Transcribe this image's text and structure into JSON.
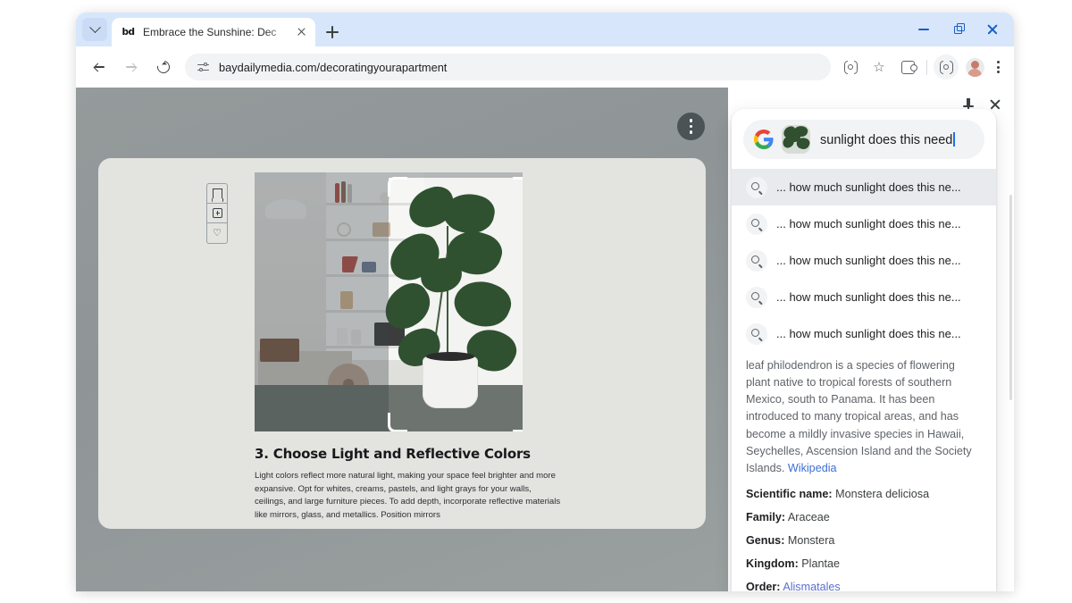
{
  "window": {
    "tab_search_icon": "chevron-down-icon",
    "minimize_label": "—",
    "restore_label": "restore",
    "close_label": "✕"
  },
  "tab": {
    "favicon_text": "bd",
    "title": "Embrace the Sunshine: Dec",
    "close_label": "✕",
    "new_tab_label": "+"
  },
  "toolbar": {
    "back_label": "back",
    "forward_label": "forward",
    "reload_label": "reload",
    "site_info_icon": "tune-icon",
    "url": "baydailymedia.com/decoratingyourapartment",
    "lens_icon": "lens-icon",
    "bookmark_star": "☆",
    "extensions_icon": "puzzle-icon",
    "lens_active_icon": "lens-icon",
    "avatar_icon": "avatar",
    "menu_icon": "kebab-icon"
  },
  "page": {
    "card_actions": [
      "bookmark-icon",
      "comment-add-icon",
      "heart-icon"
    ],
    "heart_glyph": "♡",
    "overflow_menu": "page-kebab",
    "article": {
      "heading": "3. Choose Light and Reflective Colors",
      "body": "Light colors reflect more natural light, making your space feel brighter and more expansive. Opt for whites, creams, pastels, and light grays for your walls, ceilings, and large furniture pieces. To add depth, incorporate reflective materials like mirrors, glass, and metallics. Position mirrors"
    }
  },
  "sidepanel": {
    "pin_label": "pin",
    "close_label": "close",
    "search": {
      "google_logo": "google-g-icon",
      "thumbnail": "selection-thumbnail",
      "query": "sunlight does this need"
    },
    "suggestions": [
      {
        "text": "... how much sunlight does this ne...",
        "selected": true
      },
      {
        "text": "... how much sunlight does this ne...",
        "selected": false
      },
      {
        "text": "... how much sunlight does this ne...",
        "selected": false
      },
      {
        "text": "... how much sunlight does this ne...",
        "selected": false
      },
      {
        "text": "... how much sunlight does this ne...",
        "selected": false
      }
    ],
    "knowledge": {
      "description": "leaf philodendron is a species of flowering plant native to tropical forests of southern Mexico, south to Panama. It has been introduced to many tropical areas, and has become a mildly invasive species in Hawaii, Seychelles, Ascension Island and the Society Islands. ",
      "source_link": "Wikipedia",
      "facts": [
        {
          "label": "Scientific name:",
          "value": "Monstera deliciosa",
          "is_link": false
        },
        {
          "label": "Family:",
          "value": "Araceae",
          "is_link": false
        },
        {
          "label": "Genus:",
          "value": "Monstera",
          "is_link": false
        },
        {
          "label": "Kingdom:",
          "value": "Plantae",
          "is_link": false
        },
        {
          "label": "Order:",
          "value": "Alismatales",
          "is_link": true
        }
      ]
    }
  },
  "colors": {
    "tabstrip": "#d7e6fb",
    "window_control": "#1a5dc4",
    "link": "#3c6fd1",
    "selection_highlight": "#e8eaed",
    "page_backdrop": "#8f9597",
    "article_card": "#e3e3e0"
  }
}
